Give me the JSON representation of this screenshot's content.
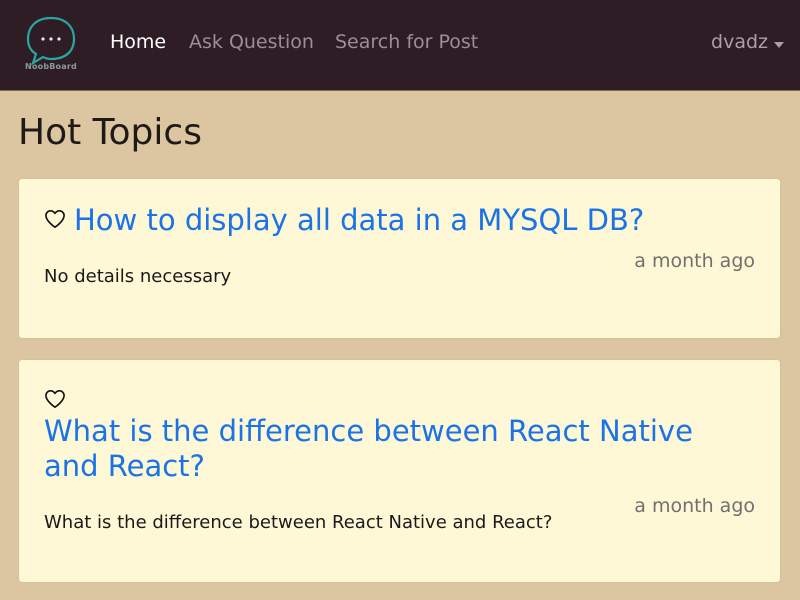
{
  "navbar": {
    "brand": "NoobBoard",
    "links": [
      {
        "label": "Home",
        "active": true
      },
      {
        "label": "Ask Question",
        "active": false
      },
      {
        "label": "Search for Post",
        "active": false
      }
    ],
    "user": "dvadz"
  },
  "page": {
    "title": "Hot Topics"
  },
  "posts": [
    {
      "title": "How to display all data in a MYSQL DB?",
      "time": "a month ago",
      "body": "No details necessary",
      "favorite_icon": "heart-outline-icon"
    },
    {
      "title_line1": "What is the difference between React Native",
      "title_line2": "and React?",
      "time": "a month ago",
      "body": "What is the difference between React Native and React?",
      "favorite_icon": "heart-outline-icon"
    }
  ],
  "colors": {
    "navbar_bg": "#2e1d25",
    "page_bg": "#dcc5a1",
    "card_bg": "#fff8d6",
    "link": "#1a73e8",
    "logo_accent": "#2aa6a0"
  }
}
